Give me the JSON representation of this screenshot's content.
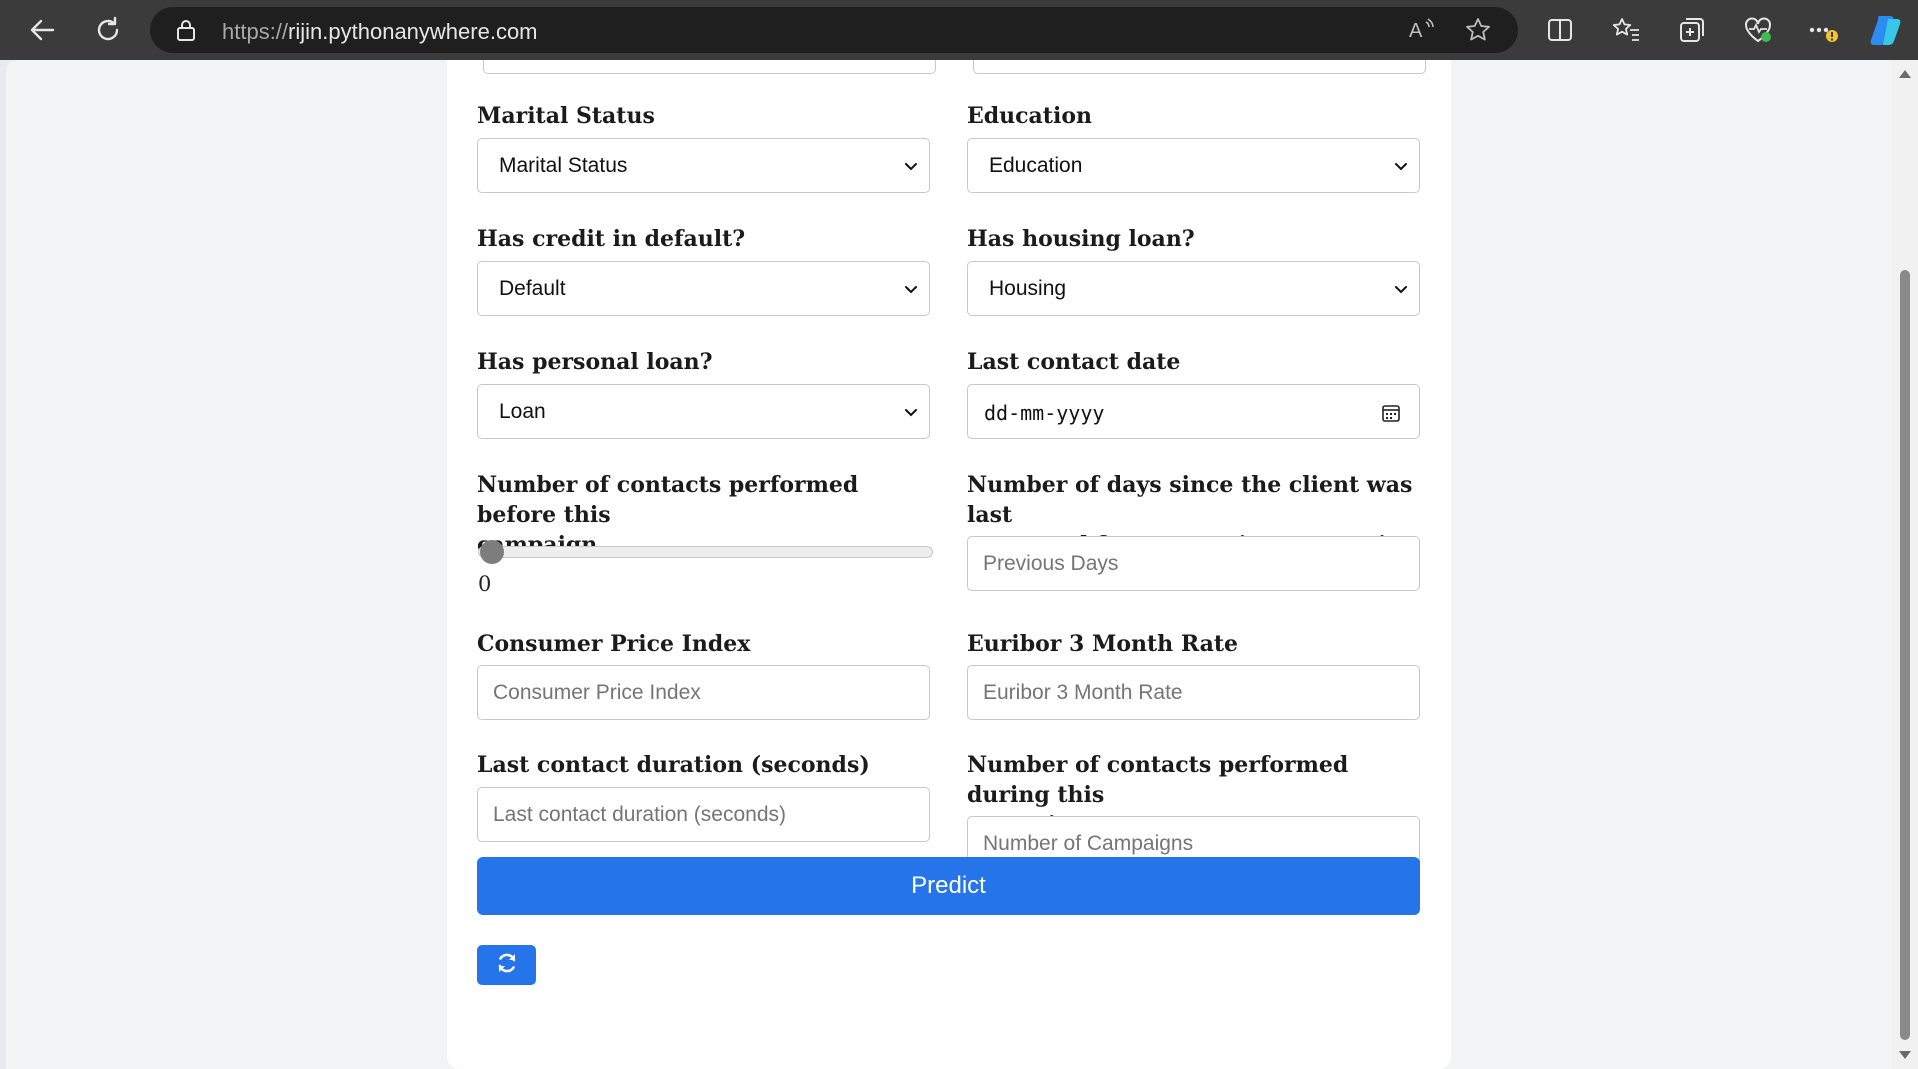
{
  "browser": {
    "url_scheme": "https://",
    "url_host": "rijin.pythonanywhere.com"
  },
  "form": {
    "marital": {
      "label": "Marital Status",
      "value": "Marital Status"
    },
    "education": {
      "label": "Education",
      "value": "Education"
    },
    "default": {
      "label": "Has credit in default?",
      "value": "Default"
    },
    "housing": {
      "label": "Has housing loan?",
      "value": "Housing"
    },
    "loan": {
      "label": "Has personal loan?",
      "value": "Loan"
    },
    "contact_date": {
      "label": "Last contact date",
      "placeholder": "dd-mm-yyyy"
    },
    "previous": {
      "label_line1": "Number of contacts performed before this",
      "label_line2": "campaign",
      "value": "0",
      "value_fraction": 0
    },
    "pdays": {
      "label_line1": "Number of days since the client was last",
      "label_line2": "contacted from a previous campaign",
      "placeholder": "Previous Days"
    },
    "cpi": {
      "label": "Consumer Price Index",
      "placeholder": "Consumer Price Index"
    },
    "euribor": {
      "label": "Euribor 3 Month Rate",
      "placeholder": "Euribor 3 Month Rate"
    },
    "duration": {
      "label": "Last contact duration (seconds)",
      "placeholder": "Last contact duration (seconds)"
    },
    "campaign": {
      "label_line1": "Number of contacts performed during this",
      "label_line2": "campaign",
      "placeholder": "Number of Campaigns"
    },
    "predict_label": "Predict"
  },
  "colors": {
    "accent": "#2574e9",
    "chrome": "#3b3b3b"
  }
}
